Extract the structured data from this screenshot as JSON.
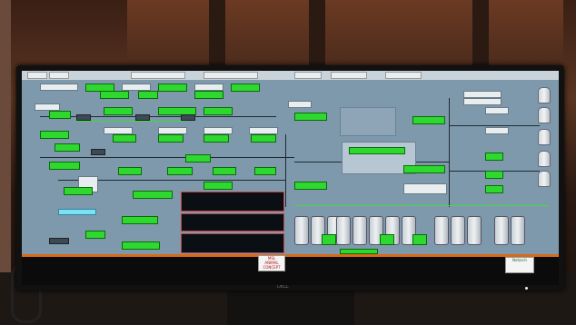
{
  "screen": {
    "tabs": [
      "",
      "",
      "",
      "",
      "",
      "",
      ""
    ],
    "badge_left": {
      "line1": "MSL",
      "line2": "ANIMAL CONCEPT"
    },
    "badge_right": {
      "line1": "",
      "line2": "Netzsch"
    }
  },
  "colors": {
    "hmi_background": "#7f99ac",
    "status_green": "#2fd82f",
    "alarm_orange": "#d66a1a"
  },
  "monitor": {
    "brand": "DELL"
  }
}
